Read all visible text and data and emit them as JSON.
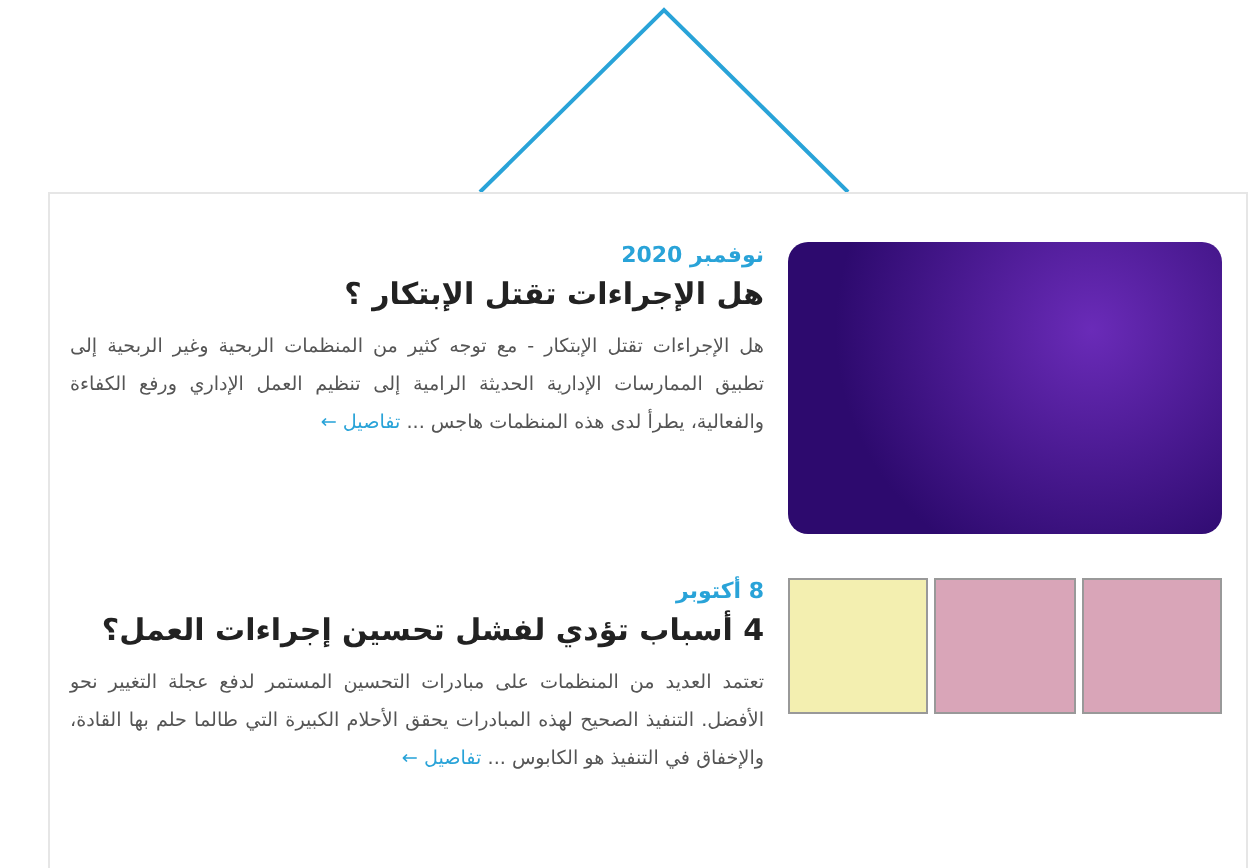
{
  "articles": [
    {
      "date": "نوفمبر 2020",
      "title": "هل الإجراءات تقتل الإبتكار ؟",
      "excerpt": "هل الإجراءات تقتل الإبتكار - مع توجه كثير من المنظمات الربحية وغير الربحية إلى تطبيق الممارسات الإدارية الحديثة الرامية إلى تنظيم العمل الإداري ورفع الكفاءة والفعالية، يطرأ لدى هذه المنظمات هاجس ...",
      "link": "تفاصيل ←",
      "image": {
        "kind": "illustration"
      }
    },
    {
      "date": "8 أكتوبر",
      "title": "4 أسباب تؤدي لفشل تحسين إجراءات العمل؟",
      "excerpt": "تعتمد العديد من المنظمات على مبادرات التحسين المستمر لدفع عجلة التغيير نحو الأفضل. التنفيذ الصحيح لهذه المبادرات يحقق الأحلام الكبيرة التي طالما حلم بها القادة، والإخفاق في التنفيذ هو الكابوس ...",
      "link": "تفاصيل ←",
      "image": {
        "kind": "comic"
      }
    }
  ]
}
